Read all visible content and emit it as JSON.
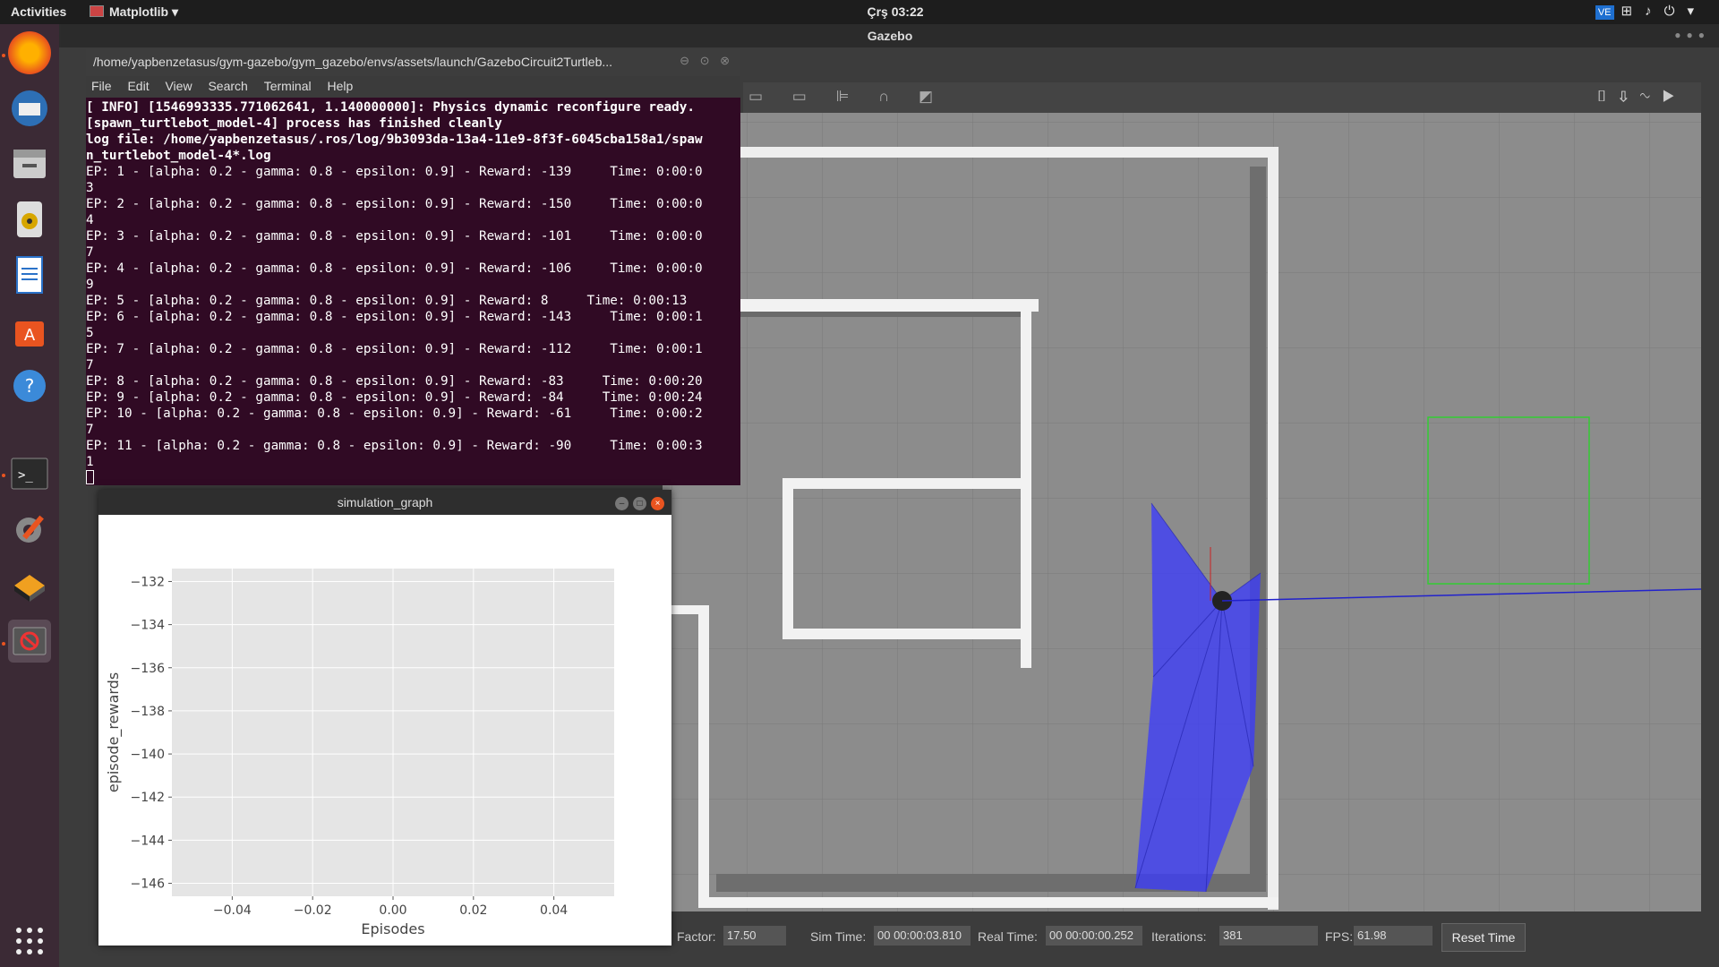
{
  "topbar": {
    "activities": "Activities",
    "app_name": "Matplotlib",
    "clock": "Çrş 03:22",
    "tray_vs": "VE"
  },
  "gazebo": {
    "title": "Gazebo",
    "status": {
      "factor_label": "Factor:",
      "factor_value": "17.50",
      "sim_time_label": "Sim Time:",
      "sim_time_value": "00 00:00:03.810",
      "real_time_label": "Real Time:",
      "real_time_value": "00 00:00:00.252",
      "iterations_label": "Iterations:",
      "iterations_value": "381",
      "fps_label": "FPS:",
      "fps_value": "61.98",
      "reset_label": "Reset Time"
    }
  },
  "terminal": {
    "title": "/home/yapbenzetasus/gym-gazebo/gym_gazebo/envs/assets/launch/GazeboCircuit2Turtleb...",
    "menu": [
      "File",
      "Edit",
      "View",
      "Search",
      "Terminal",
      "Help"
    ],
    "lines": [
      "[ INFO] [1546993335.771062641, 1.140000000]: Physics dynamic reconfigure ready.",
      "[spawn_turtlebot_model-4] process has finished cleanly",
      "log file: /home/yapbenzetasus/.ros/log/9b3093da-13a4-11e9-8f3f-6045cba158a1/spaw",
      "n_turtlebot_model-4*.log",
      "EP: 1 - [alpha: 0.2 - gamma: 0.8 - epsilon: 0.9] - Reward: -139     Time: 0:00:0",
      "3",
      "EP: 2 - [alpha: 0.2 - gamma: 0.8 - epsilon: 0.9] - Reward: -150     Time: 0:00:0",
      "4",
      "EP: 3 - [alpha: 0.2 - gamma: 0.8 - epsilon: 0.9] - Reward: -101     Time: 0:00:0",
      "7",
      "EP: 4 - [alpha: 0.2 - gamma: 0.8 - epsilon: 0.9] - Reward: -106     Time: 0:00:0",
      "9",
      "EP: 5 - [alpha: 0.2 - gamma: 0.8 - epsilon: 0.9] - Reward: 8     Time: 0:00:13",
      "EP: 6 - [alpha: 0.2 - gamma: 0.8 - epsilon: 0.9] - Reward: -143     Time: 0:00:1",
      "5",
      "EP: 7 - [alpha: 0.2 - gamma: 0.8 - epsilon: 0.9] - Reward: -112     Time: 0:00:1",
      "7",
      "EP: 8 - [alpha: 0.2 - gamma: 0.8 - epsilon: 0.9] - Reward: -83     Time: 0:00:20",
      "EP: 9 - [alpha: 0.2 - gamma: 0.8 - epsilon: 0.9] - Reward: -84     Time: 0:00:24",
      "EP: 10 - [alpha: 0.2 - gamma: 0.8 - epsilon: 0.9] - Reward: -61     Time: 0:00:2",
      "7",
      "EP: 11 - [alpha: 0.2 - gamma: 0.8 - epsilon: 0.9] - Reward: -90     Time: 0:00:3",
      "1"
    ]
  },
  "graph_window": {
    "title": "simulation_graph"
  },
  "chart_data": {
    "type": "line",
    "xlabel": "Episodes",
    "ylabel": "episode_rewards",
    "xlim": [
      -0.055,
      0.055
    ],
    "ylim": [
      -146.6,
      -131.4
    ],
    "xticks": [
      "−0.04",
      "−0.02",
      "0.00",
      "0.02",
      "0.04"
    ],
    "xtick_values": [
      -0.04,
      -0.02,
      0.0,
      0.02,
      0.04
    ],
    "yticks": [
      "−132",
      "−134",
      "−136",
      "−138",
      "−140",
      "−142",
      "−144",
      "−146"
    ],
    "ytick_values": [
      -132,
      -134,
      -136,
      -138,
      -140,
      -142,
      -144,
      -146
    ],
    "series": [],
    "grid": true,
    "background": "#e5e5e5"
  },
  "colors": {
    "dock_bg": "#3b2a35",
    "terminal_bg": "#300a24",
    "accent": "#e95420",
    "laser": "#3a3aff"
  }
}
